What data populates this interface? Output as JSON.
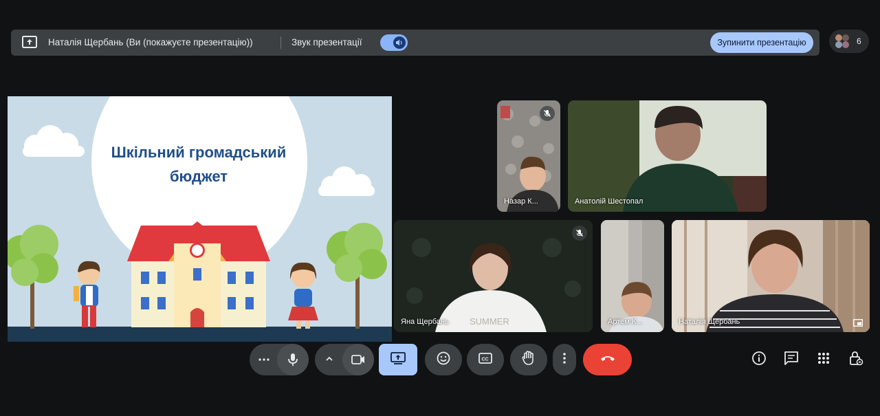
{
  "topbar": {
    "presenting_text": "Наталія Щербань (Ви (покажуєте презентацію))",
    "audio_label": "Звук презентації",
    "audio_enabled": true,
    "stop_button_label": "Зупинити презентацію",
    "accent_color": "#a8c7fa"
  },
  "participants": {
    "count": "6"
  },
  "slide": {
    "title": "Шкільний громадський бюджет"
  },
  "tiles": [
    {
      "name": "Назар К...",
      "muted": true
    },
    {
      "name": "Анатолій Шестопал",
      "muted": false
    },
    {
      "name": "Яна Щербань",
      "muted": true
    },
    {
      "name": "Артем К...",
      "muted": false
    },
    {
      "name": "Наталія Щербань",
      "muted": false,
      "active": true
    }
  ],
  "controls": {
    "more_options": "more-vert-icon",
    "mic": "mic-icon",
    "camera": "videocam-icon",
    "present": "present-to-all-icon",
    "reactions": "emoji-icon",
    "captions": "closed-caption-icon",
    "raise_hand": "hand-icon",
    "end_call_color": "#ea4335"
  },
  "side_tools": [
    "info-icon",
    "chat-icon",
    "activities-icon",
    "host-controls-icon"
  ]
}
